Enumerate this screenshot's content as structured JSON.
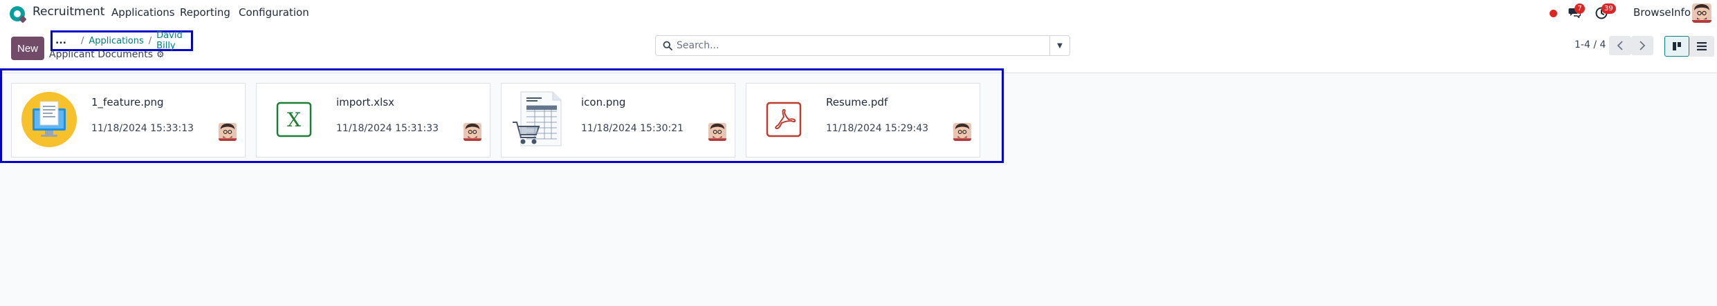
{
  "navbar": {
    "app_name": "Recruitment",
    "menu": [
      "Applications",
      "Reporting",
      "Configuration"
    ],
    "chat_count": "7",
    "activity_count": "39",
    "company": "BrowseInfo"
  },
  "control": {
    "new_label": "New",
    "breadcrumb": {
      "more": "...",
      "items": [
        "Applications",
        "David Billy"
      ]
    },
    "subtitle": "Applicant Documents",
    "search_placeholder": "Search...",
    "pager": "1-4 / 4"
  },
  "documents": [
    {
      "name": "1_feature.png",
      "date": "11/18/2024 15:33:13",
      "thumb": "monitor-document-icon"
    },
    {
      "name": "import.xlsx",
      "date": "11/18/2024 15:31:33",
      "thumb": "excel-file-icon"
    },
    {
      "name": "icon.png",
      "date": "11/18/2024 15:30:21",
      "thumb": "purchase-order-icon"
    },
    {
      "name": "Resume.pdf",
      "date": "11/18/2024 15:29:43",
      "thumb": "pdf-file-icon"
    }
  ],
  "colors": {
    "brand": "#714b67",
    "link": "#017e84",
    "highlight": "#0000cc",
    "badge": "#dc2626"
  }
}
